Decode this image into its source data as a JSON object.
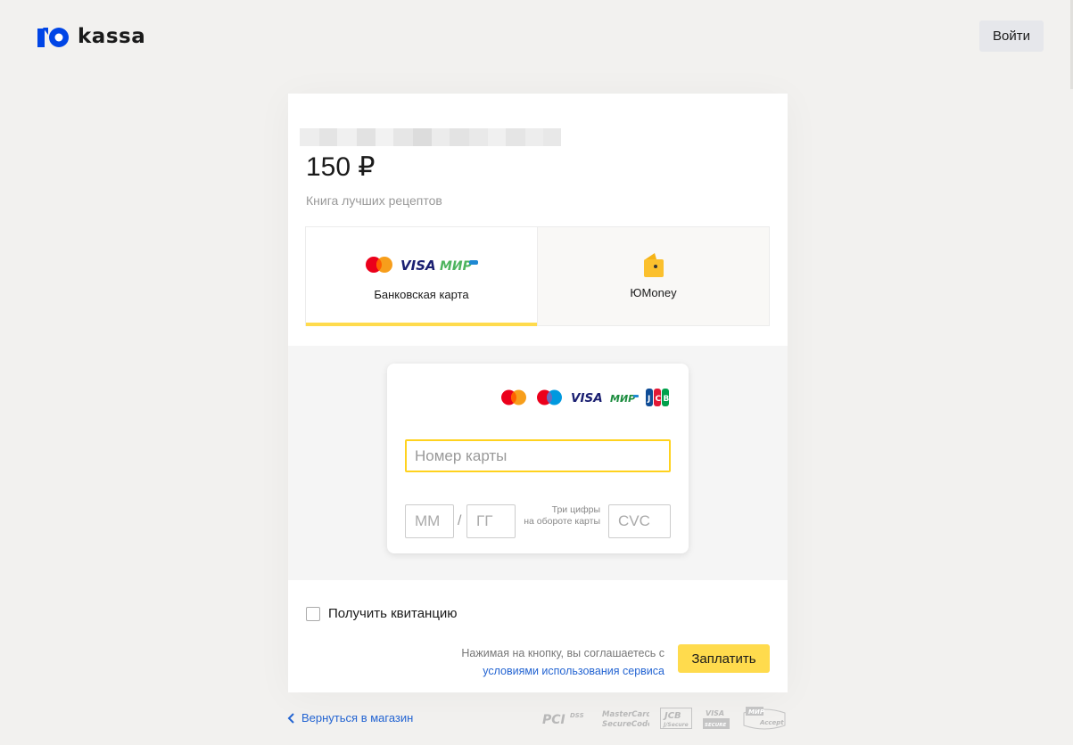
{
  "header": {
    "brand": "kassa",
    "login_label": "Войти"
  },
  "payment": {
    "amount": "150 ₽",
    "description": "Книга лучших рецептов"
  },
  "methods": {
    "tabs": [
      {
        "label": "Банковская карта",
        "icons": [
          "mastercard-icon",
          "visa-icon",
          "mir-icon"
        ]
      },
      {
        "label": "ЮMoney",
        "icons": [
          "yoomoney-wallet-icon"
        ]
      }
    ],
    "card_brands": [
      "mastercard",
      "maestro",
      "visa",
      "mir",
      "jcb"
    ]
  },
  "form": {
    "pan_placeholder": "Номер карты",
    "month_placeholder": "ММ",
    "year_placeholder": "ГГ",
    "separator": "/",
    "cvc_hint_line1": "Три цифры",
    "cvc_hint_line2": "на обороте карты",
    "cvc_placeholder": "CVC"
  },
  "receipt": {
    "label": "Получить квитанцию",
    "checked": false
  },
  "footer": {
    "agree_text": "Нажимая на кнопку, вы соглашаетесь с",
    "terms_link": "условиями использования сервиса",
    "pay_label": "Заплатить",
    "back_label": "Вернуться в магазин",
    "certifications": [
      "PCI DSS",
      "MasterCard SecureCode",
      "JCB J/Secure",
      "VISA SECURE",
      "MIR Accept"
    ]
  },
  "colors": {
    "accent_yellow": "#ffdb4d",
    "link_blue": "#2364d2",
    "brand_blue": "#0045e6",
    "focus_border": "#ffd21e"
  }
}
